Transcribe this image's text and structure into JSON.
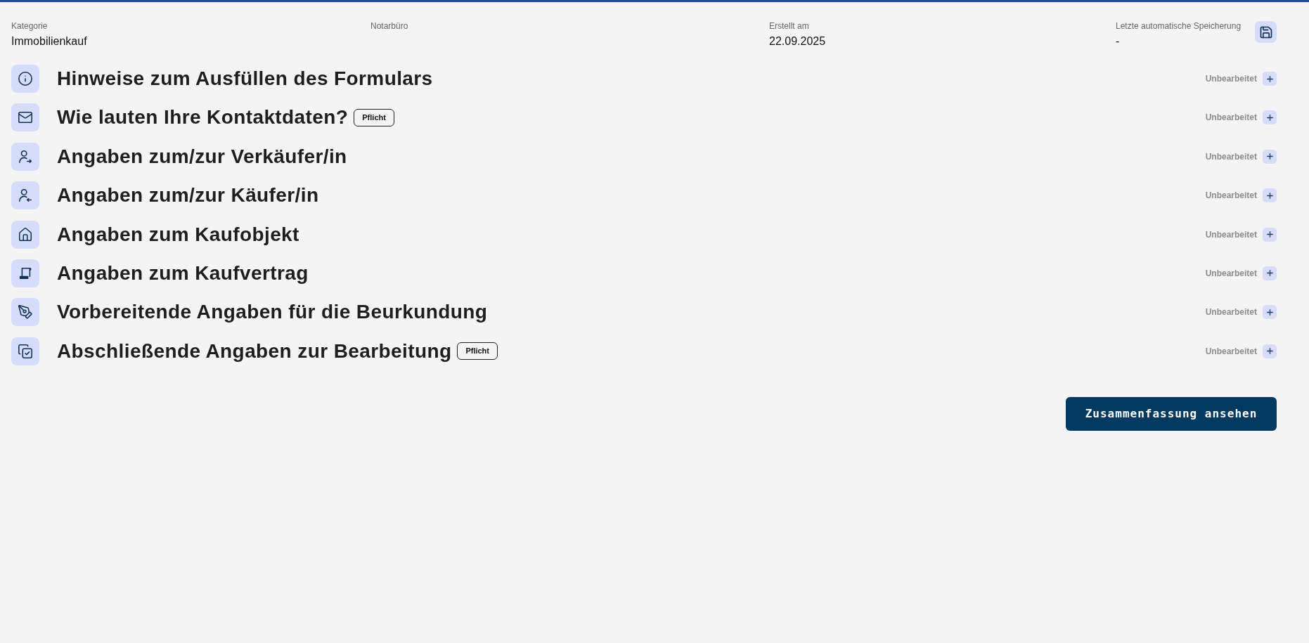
{
  "header": {
    "fields": [
      {
        "label": "Kategorie",
        "value": "Immobilienkauf"
      },
      {
        "label": "Notarbüro"
      },
      {
        "label": "Erstellt am",
        "value": "22.09.2025"
      },
      {
        "label": "Letzte automatische Speicherung",
        "value": "-"
      }
    ]
  },
  "sections": [
    {
      "title": "Hinweise zum Ausfüllen des Formulars",
      "status": "Unbearbeitet",
      "expanded": false
    },
    {
      "title": "Wie lauten Ihre Kontaktdaten?",
      "badge": "Pflicht",
      "status": "Unbearbeitet",
      "expanded": false
    },
    {
      "title": "Angaben zum/zur Verkäufer/in",
      "status": "Unbearbeitet",
      "expanded": false
    },
    {
      "title": "Angaben zum/zur Käufer/in",
      "status": "Unbearbeitet",
      "expanded": false
    },
    {
      "title": "Angaben zum Kaufobjekt",
      "status": "Unbearbeitet",
      "expanded": false
    },
    {
      "title": "Angaben zum Kaufvertrag",
      "status": "Unbearbeitet",
      "expanded": false
    },
    {
      "title": "Vorbereitende Angaben für die Beurkundung",
      "status": "Unbearbeitet",
      "expanded": false
    },
    {
      "title": "Abschließende Angaben zur Bearbeitung",
      "badge": "Pflicht",
      "status": "Unbearbeitet",
      "expanded": false
    }
  ],
  "summary_button": "Zusammenfassung ansehen"
}
